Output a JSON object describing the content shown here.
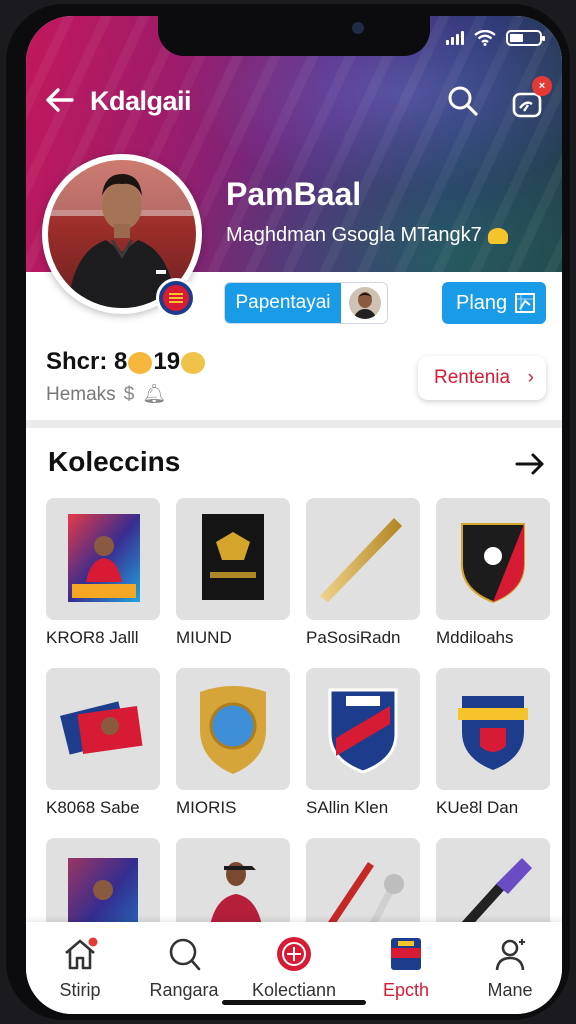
{
  "header": {
    "app_title": "Kdalgaii",
    "notif_count": "×"
  },
  "profile": {
    "name": "PamBaal",
    "subtitle": "Maghdman Gsogla MTangk7",
    "follow_label": "Papentayai",
    "play_label": "Plang",
    "score_prefix": "Shcr: 8",
    "score_suffix": "19",
    "meta": "Hemaks",
    "meta_symbol": "$",
    "rent_label": "Rentenia",
    "rent_chevron": "›"
  },
  "collections": {
    "title": "Koleccins",
    "items": [
      {
        "label": "KROR8 Jalll",
        "icon": "trading-card-icon"
      },
      {
        "label": "MIUND",
        "icon": "dark-card-icon"
      },
      {
        "label": "PaSosiRadn",
        "icon": "gold-bat-icon"
      },
      {
        "label": "Mddiloahs",
        "icon": "club-shield-icon"
      },
      {
        "label": "K8068 Sabe",
        "icon": "card-stack-icon"
      },
      {
        "label": "MIORIS",
        "icon": "gold-shield-icon"
      },
      {
        "label": "SAllin Klen",
        "icon": "blue-badge-icon"
      },
      {
        "label": "KUe8l Dan",
        "icon": "crest-badge-icon"
      },
      {
        "label": "",
        "icon": "player-poster-icon"
      },
      {
        "label": "",
        "icon": "player-figure-icon"
      },
      {
        "label": "",
        "icon": "red-baton-icon"
      },
      {
        "label": "",
        "icon": "purple-torch-icon"
      }
    ]
  },
  "nav": [
    {
      "label": "Stirip",
      "icon": "home-icon"
    },
    {
      "label": "Rangara",
      "icon": "search-icon"
    },
    {
      "label": "Kolectiann",
      "icon": "collection-icon"
    },
    {
      "label": "Epcth",
      "icon": "badge-icon",
      "active": true
    },
    {
      "label": "Mane",
      "icon": "profile-icon"
    }
  ],
  "colors": {
    "accent": "#1a9be8",
    "active_red": "#d81b34"
  }
}
